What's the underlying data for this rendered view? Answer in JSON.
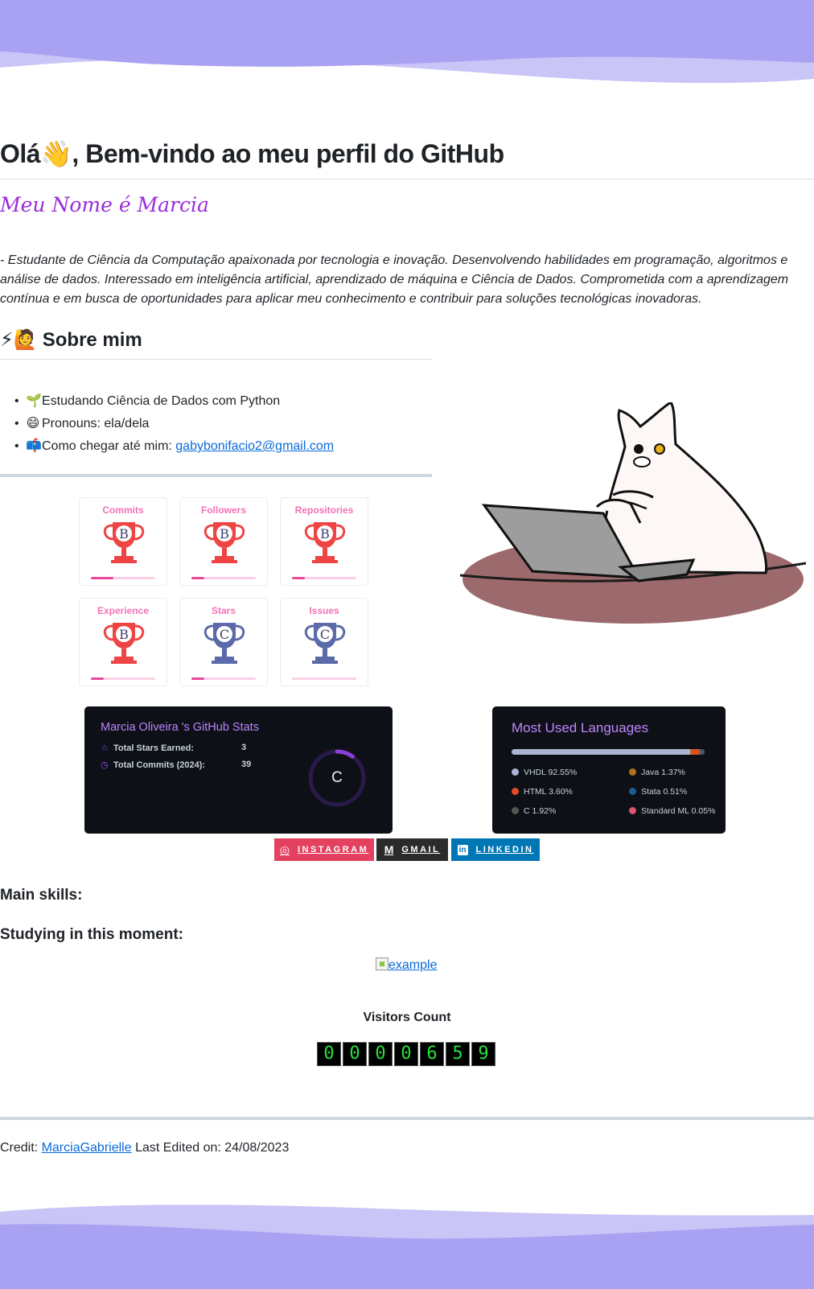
{
  "header": {
    "title": "Olá👋, Bem-vindo ao meu perfil do GitHub",
    "name_banner": "Meu Nome é Marcia",
    "intro": "- Estudante de Ciência da Computação apaixonada por tecnologia e inovação. Desenvolvendo habilidades em programação, algoritmos e análise de dados. Interessado em inteligência artificial, aprendizado de máquina e Ciência de Dados. Comprometida com a aprendizagem contínua e em busca de oportunidades para aplicar meu conhecimento e contribuir para soluções tecnológicas inovadoras."
  },
  "about": {
    "heading": "Sobre mim",
    "heading_icons": "⚡🙋",
    "items": [
      {
        "icon": "🌱",
        "text": "Estudando Ciência de Dados com Python"
      },
      {
        "icon": "😄",
        "text": "Pronouns: ela/dela"
      },
      {
        "icon": "📫",
        "text": "Como chegar até mim: ",
        "link": "gabybonifacio2@gmail.com"
      }
    ]
  },
  "trophies": [
    {
      "title": "Commits",
      "rank": "B",
      "color": "#ef4444",
      "progress": 0.35
    },
    {
      "title": "Followers",
      "rank": "B",
      "color": "#ef4444",
      "progress": 0.2
    },
    {
      "title": "Repositories",
      "rank": "B",
      "color": "#ef4444",
      "progress": 0.2
    },
    {
      "title": "Experience",
      "rank": "B",
      "color": "#ef4444",
      "progress": 0.2
    },
    {
      "title": "Stars",
      "rank": "C",
      "color": "#5b6aa8",
      "progress": 0.2
    },
    {
      "title": "Issues",
      "rank": "C",
      "color": "#5b6aa8",
      "progress": 0.0
    }
  ],
  "stats": {
    "title": "Marcia Oliveira 's GitHub Stats",
    "rows": [
      {
        "icon": "star-icon",
        "glyph": "☆",
        "label": "Total Stars Earned:",
        "value": "3"
      },
      {
        "icon": "clock-icon",
        "glyph": "◷",
        "label": "Total Commits (2024):",
        "value": "39"
      }
    ],
    "rank": "C",
    "rank_progress": 0.1
  },
  "languages": {
    "title": "Most Used Languages",
    "items": [
      {
        "name": "VHDL",
        "percent": "92.55%",
        "value": 92.55,
        "color": "#adb2d3"
      },
      {
        "name": "Java",
        "percent": "1.37%",
        "value": 1.37,
        "color": "#b07219"
      },
      {
        "name": "HTML",
        "percent": "3.60%",
        "value": 3.6,
        "color": "#e34c26"
      },
      {
        "name": "Stata",
        "percent": "0.51%",
        "value": 0.51,
        "color": "#1a5f91"
      },
      {
        "name": "C",
        "percent": "1.92%",
        "value": 1.92,
        "color": "#555555"
      },
      {
        "name": "Standard ML",
        "percent": "0.05%",
        "value": 0.05,
        "color": "#dc566d"
      }
    ]
  },
  "badges": {
    "instagram": "INSTAGRAM",
    "gmail": "GMAIL",
    "linkedin": "LINKEDIN"
  },
  "sections": {
    "main_skills": "Main skills:",
    "studying": "Studying in this moment:",
    "example_alt": "example"
  },
  "visitors": {
    "label": "Visitors Count",
    "digits": [
      "0",
      "0",
      "0",
      "0",
      "6",
      "5",
      "9"
    ]
  },
  "footer": {
    "credit_prefix": "Credit: ",
    "credit_link": "MarciaGabrielle",
    "edited": " Last Edited on: 24/08/2023"
  },
  "colors": {
    "wave_dark": "#a9a2f2",
    "wave_light": "#cac5f7",
    "accent_purple": "#9b2bdc"
  }
}
